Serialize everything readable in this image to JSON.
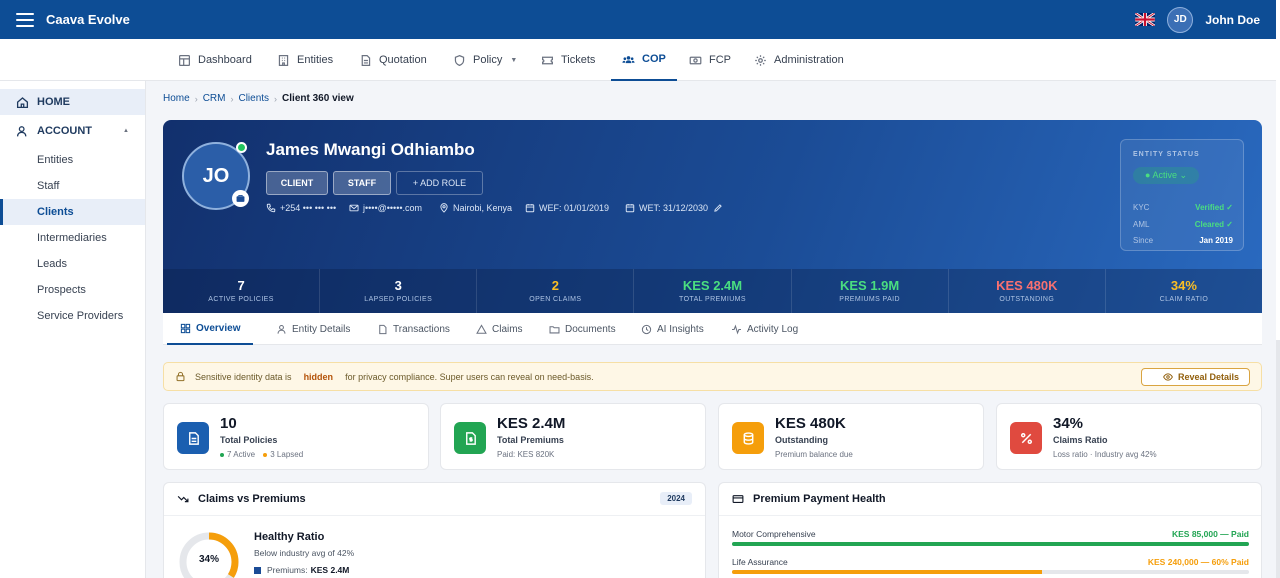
{
  "app": {
    "title": "Caava Evolve",
    "user": {
      "initials": "JD",
      "name": "John Doe"
    }
  },
  "nav": [
    {
      "label": "Dashboard",
      "icon": "dashboard-icon"
    },
    {
      "label": "Entities",
      "icon": "building-icon"
    },
    {
      "label": "Quotation",
      "icon": "document-icon"
    },
    {
      "label": "Policy",
      "icon": "shield-icon"
    },
    {
      "label": "Tickets",
      "icon": "ticket-icon"
    },
    {
      "label": "COP",
      "icon": "users-icon",
      "active": true
    },
    {
      "label": "FCP",
      "icon": "money-icon"
    },
    {
      "label": "Administration",
      "icon": "gear-icon"
    }
  ],
  "sidebar": {
    "home": "HOME",
    "account": "ACCOUNT",
    "items": [
      "Entities",
      "Staff",
      "Clients",
      "Intermediaries",
      "Leads",
      "Prospects",
      "Service Providers"
    ],
    "active": "Clients"
  },
  "breadcrumb": {
    "items": [
      "Home",
      "CRM",
      "Clients"
    ],
    "current": "Client 360 view"
  },
  "client": {
    "initials": "JO",
    "name": "James Mwangi Odhiambo",
    "roles": [
      "CLIENT",
      "STAFF"
    ],
    "add_role": "+ ADD ROLE",
    "phone": "+254 ••• ••• •••",
    "email": "j••••@•••••.com",
    "location": "Nairobi, Kenya",
    "wef": "WEF: 01/01/2019",
    "wet": "WET: 31/12/2030"
  },
  "entity_status": {
    "title": "ENTITY STATUS",
    "status": "● Active ⌄",
    "rows": [
      {
        "k": "KYC",
        "v": "Verified ✓"
      },
      {
        "k": "AML",
        "v": "Cleared ✓"
      },
      {
        "k": "Since",
        "v": "Jan 2019"
      }
    ]
  },
  "stats": [
    {
      "value": "7",
      "label": "ACTIVE POLICIES",
      "color": "#ffffff"
    },
    {
      "value": "3",
      "label": "LAPSED POLICIES",
      "color": "#ffffff"
    },
    {
      "value": "2",
      "label": "OPEN CLAIMS",
      "color": "#fbbf24"
    },
    {
      "value": "KES 2.4M",
      "label": "TOTAL PREMIUMS",
      "color": "#4ade80"
    },
    {
      "value": "KES 1.9M",
      "label": "PREMIUMS PAID",
      "color": "#4ade80"
    },
    {
      "value": "KES 480K",
      "label": "OUTSTANDING",
      "color": "#f87171"
    },
    {
      "value": "34%",
      "label": "CLAIM RATIO",
      "color": "#fbbf24"
    }
  ],
  "tabs": [
    "Overview",
    "Entity Details",
    "Transactions",
    "Claims",
    "Documents",
    "AI Insights",
    "Activity Log"
  ],
  "notice": {
    "prefix": "Sensitive identity data is",
    "bold": "hidden",
    "suffix": "for privacy compliance. Super users can reveal on need-basis.",
    "button": "Reveal Details"
  },
  "kpis": [
    {
      "value": "10",
      "label": "Total Policies",
      "sub_a": "7 Active",
      "sub_b": "3 Lapsed",
      "color": "#1b5fb0",
      "icon": "document-icon"
    },
    {
      "value": "KES 2.4M",
      "label": "Total Premiums",
      "sub": "Paid: KES 820K",
      "color": "#22a553",
      "icon": "money-file-icon"
    },
    {
      "value": "KES 480K",
      "label": "Outstanding",
      "sub": "Premium balance due",
      "color": "#f59e0b",
      "icon": "coins-icon"
    },
    {
      "value": "34%",
      "label": "Claims Ratio",
      "sub": "Loss ratio · Industry avg 42%",
      "color": "#e04a3f",
      "icon": "percent-icon"
    }
  ],
  "claims_panel": {
    "title": "Claims vs Premiums",
    "year": "2024",
    "ratio_label": "34%",
    "ratio": 0.34,
    "headline": "Healthy Ratio",
    "sub": "Below industry avg of 42%",
    "legend_label": "Premiums:",
    "legend_value": "KES 2.4M"
  },
  "payment_panel": {
    "title": "Premium Payment Health",
    "rows": [
      {
        "name": "Motor Comprehensive",
        "status": "KES 85,000 — Paid",
        "paid": 1.0,
        "color": "#22a553"
      },
      {
        "name": "Life Assurance",
        "status": "KES 240,000 — 60% Paid",
        "paid": 0.6,
        "color": "#f59e0b"
      }
    ]
  }
}
